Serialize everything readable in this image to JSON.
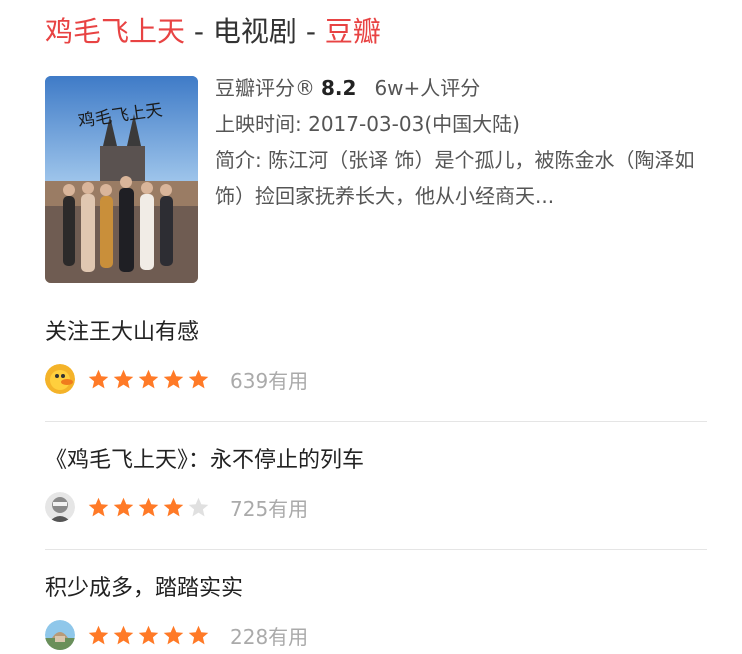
{
  "header": {
    "show_title": "鸡毛飞上天",
    "separator1": " - ",
    "category": "电视剧",
    "separator2": " - ",
    "source": "豆瓣"
  },
  "poster": {
    "title_text": "鸡毛飞上天"
  },
  "info": {
    "rating_label": "豆瓣评分®",
    "rating_value": "8.2",
    "rating_count": "6w+人评分",
    "release": "上映时间: 2017-03-03(中国大陆)",
    "summary": "简介: 陈江河（张译 饰）是个孤儿，被陈金水（陶泽如 饰）捡回家抚养长大，他从小经商天..."
  },
  "reviews": [
    {
      "title": "关注王大山有感",
      "stars": 5,
      "useful": "639有用",
      "avatar_icon": "duck-avatar-icon"
    },
    {
      "title": "《鸡毛飞上天》：永不停止的列车",
      "stars": 4,
      "useful": "725有用",
      "avatar_icon": "person-avatar-icon"
    },
    {
      "title": "积少成多，踏踏实实",
      "stars": 5,
      "useful": "228有用",
      "avatar_icon": "building-avatar-icon"
    }
  ],
  "colors": {
    "accent_red": "#e84343",
    "star_orange": "#ff7a27",
    "star_empty": "#e0e0e0"
  }
}
